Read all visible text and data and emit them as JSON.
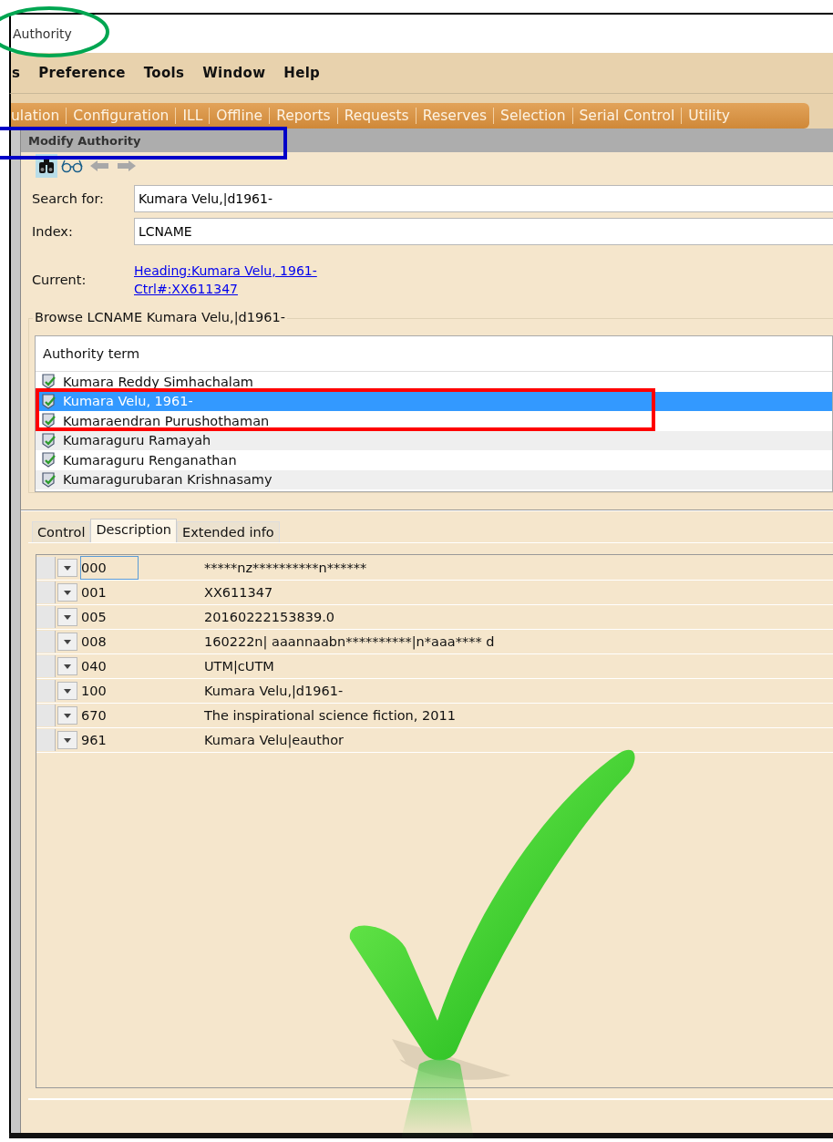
{
  "window": {
    "title": "Authority"
  },
  "menu": [
    {
      "label": "s"
    },
    {
      "label": "Preference"
    },
    {
      "label": "Tools"
    },
    {
      "label": "Window"
    },
    {
      "label": "Help"
    }
  ],
  "module_tabs": [
    {
      "label": "ulation"
    },
    {
      "label": "Configuration"
    },
    {
      "label": "ILL"
    },
    {
      "label": "Offline"
    },
    {
      "label": "Reports"
    },
    {
      "label": "Requests"
    },
    {
      "label": "Reserves"
    },
    {
      "label": "Selection"
    },
    {
      "label": "Serial Control"
    },
    {
      "label": "Utility"
    }
  ],
  "panel_title": "Modify Authority",
  "toolbar": [
    {
      "kind": "binoculars",
      "selected": true
    },
    {
      "kind": "glasses",
      "selected": false
    },
    {
      "kind": "back",
      "selected": false
    },
    {
      "kind": "forward",
      "selected": false
    }
  ],
  "form": {
    "search_label": "Search for:",
    "search_value": "Kumara Velu,|d1961-",
    "index_label": "Index:",
    "index_value": "LCNAME",
    "current_label": "Current:",
    "current_links": [
      "Heading:Kumara Velu, 1961-",
      "Ctrl#:XX611347"
    ]
  },
  "browse": {
    "title": "Browse LCNAME Kumara Velu,|d1961-",
    "column": "Authority term",
    "rows": [
      {
        "term": "Kumara Reddy Simhachalam",
        "selected": false
      },
      {
        "term": "Kumara Velu, 1961-",
        "selected": true
      },
      {
        "term": "Kumaraendran Purushothaman",
        "selected": false
      },
      {
        "term": "Kumaraguru Ramayah",
        "selected": false
      },
      {
        "term": "Kumaraguru Renganathan",
        "selected": false
      },
      {
        "term": "Kumaragurubaran Krishnasamy",
        "selected": false
      }
    ]
  },
  "record_tabs": [
    {
      "label": "Control",
      "selected": false
    },
    {
      "label": "Description",
      "selected": true
    },
    {
      "label": "Extended info",
      "selected": false
    }
  ],
  "fields": [
    {
      "tag": "000",
      "value": "*****nz**********n******",
      "focused": true
    },
    {
      "tag": "001",
      "value": "XX611347",
      "focused": false
    },
    {
      "tag": "005",
      "value": "20160222153839.0",
      "focused": false
    },
    {
      "tag": "008",
      "value": "160222n| aaannaabn**********|n*aaa**** d",
      "focused": false
    },
    {
      "tag": "040",
      "value": "UTM|cUTM",
      "focused": false
    },
    {
      "tag": "100",
      "value": "Kumara Velu,|d1961-",
      "focused": false
    },
    {
      "tag": "670",
      "value": "The inspirational science fiction, 2011",
      "focused": false
    },
    {
      "tag": "961",
      "value": "Kumara Velu|eauthor",
      "focused": false
    }
  ]
}
